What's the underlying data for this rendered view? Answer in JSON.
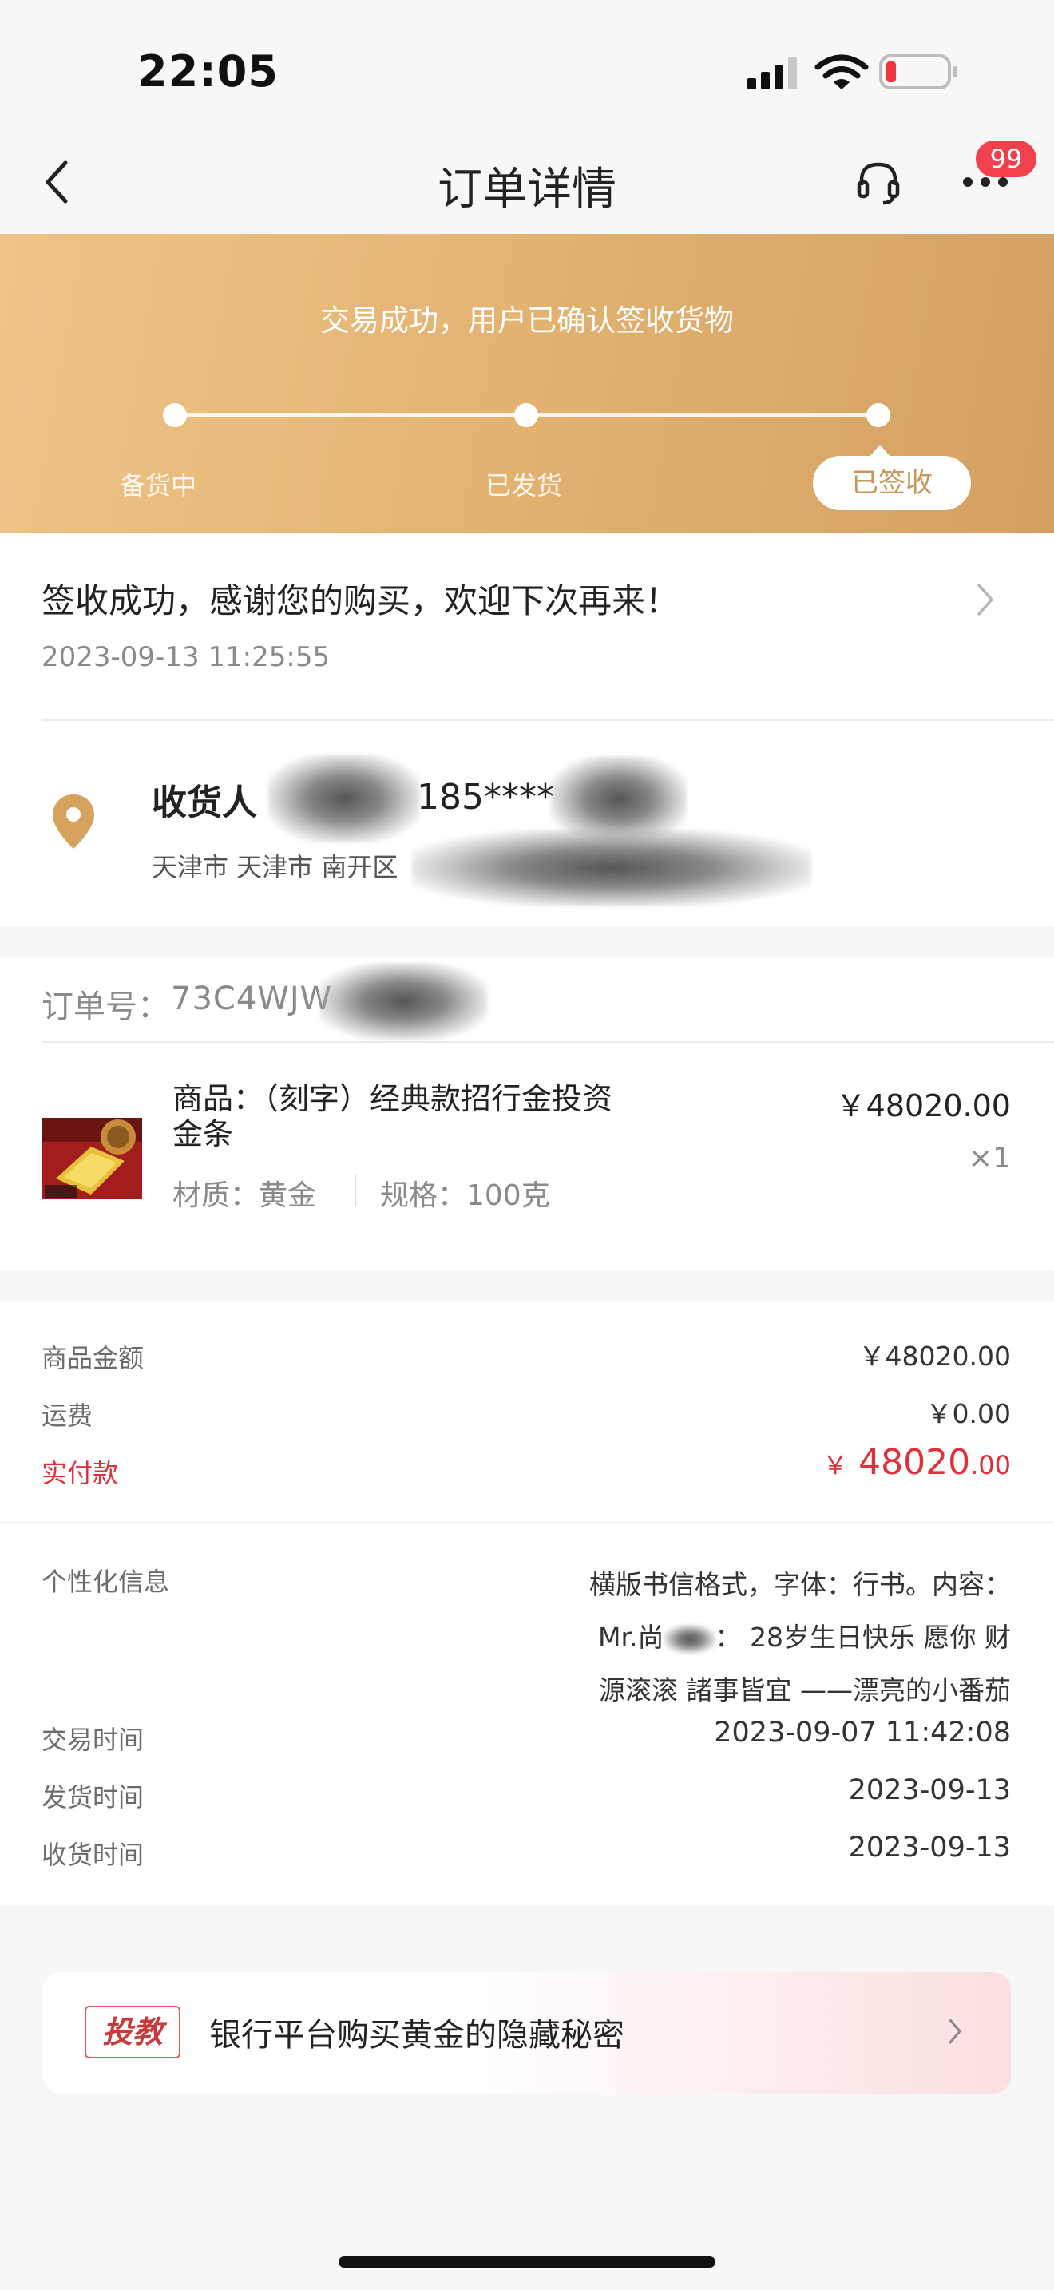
{
  "status_bar": {
    "time": "22:05"
  },
  "nav": {
    "title": "订单详情",
    "badge": "99"
  },
  "banner": {
    "message": "交易成功，用户已确认签收货物",
    "steps": [
      "备货中",
      "已发货",
      "已签收"
    ]
  },
  "receipt": {
    "headline": "签收成功，感谢您的购买，欢迎下次再来！",
    "time": "2023-09-13 11:25:55"
  },
  "address": {
    "receiver_label": "收货人",
    "phone_partial": "185****",
    "address_partial": "天津市 天津市 南开区"
  },
  "order": {
    "number_label": "订单号：",
    "number_partial": "73C4WJW"
  },
  "product": {
    "name_line1": "商品：（刻字）经典款招行金投资",
    "name_line2": "金条",
    "material": "材质：黄金",
    "spec": "规格：100克",
    "price": "￥48020.00",
    "quantity": "×1"
  },
  "summary": {
    "goods_amount_label": "商品金额",
    "goods_amount": "￥48020.00",
    "shipping_label": "运费",
    "shipping": "￥0.00",
    "paid_label": "实付款",
    "paid_currency": "￥",
    "paid_int": "48020",
    "paid_dec": ".00"
  },
  "details": {
    "personal_label": "个性化信息",
    "personal_line1": "横版书信格式，字体：行书。内容：",
    "personal_line2a": "Mr.尚",
    "personal_line2b": "：  28岁生日快乐 愿你 财",
    "personal_line3": "源滚滚 諸事皆宜 ——漂亮的小番茄",
    "trade_time_label": "交易时间",
    "trade_time": "2023-09-07 11:42:08",
    "ship_time_label": "发货时间",
    "ship_time": "2023-09-13",
    "receive_time_label": "收货时间",
    "receive_time": "2023-09-13"
  },
  "ad": {
    "tag": "投教",
    "text": "银行平台购买黄金的隐藏秘密"
  },
  "colors": {
    "banner_gold": "#e2b271",
    "paid_red": "#e0313a",
    "active_step_text": "#c8975a"
  }
}
